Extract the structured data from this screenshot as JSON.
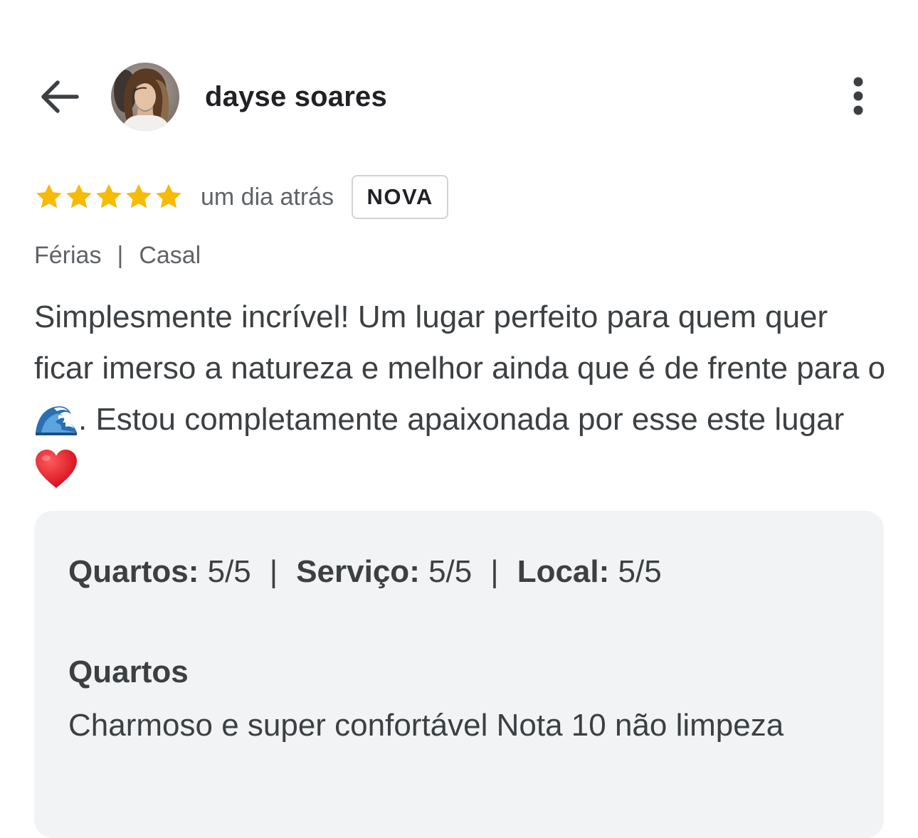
{
  "header": {
    "back_icon": "arrow-left-icon",
    "avatar_icon": "user-avatar",
    "username": "dayse soares",
    "more_icon": "more-vert-icon"
  },
  "review": {
    "rating": 5,
    "rating_max": 5,
    "star_color": "#f6bb06",
    "time_ago": "um dia atrás",
    "badge": "NOVA",
    "tags": [
      "Férias",
      "Casal"
    ],
    "tag_separator": "|",
    "text_before_emoji": "Simplesmente incrível! Um lugar perfeito para quem quer ficar imerso a natureza e melhor ainda que é de frente para o ",
    "wave_emoji": "wave-emoji",
    "text_after_emoji": ". Estou completamente apaixonada por esse este lugar ",
    "heart_emoji": "heart-emoji"
  },
  "details": {
    "scores": [
      {
        "label": "Quartos:",
        "value": "5/5"
      },
      {
        "label": "Serviço:",
        "value": "5/5"
      },
      {
        "label": "Local:",
        "value": "5/5"
      }
    ],
    "score_separator": "|",
    "section_title": "Quartos",
    "section_text": "Charmoso e super confortável Nota 10 não limpeza"
  },
  "colors": {
    "card_background": "#f1f3f4",
    "badge_border": "#d0d3d7",
    "primary_text": "#3c4043",
    "secondary_text": "#5f6368"
  }
}
